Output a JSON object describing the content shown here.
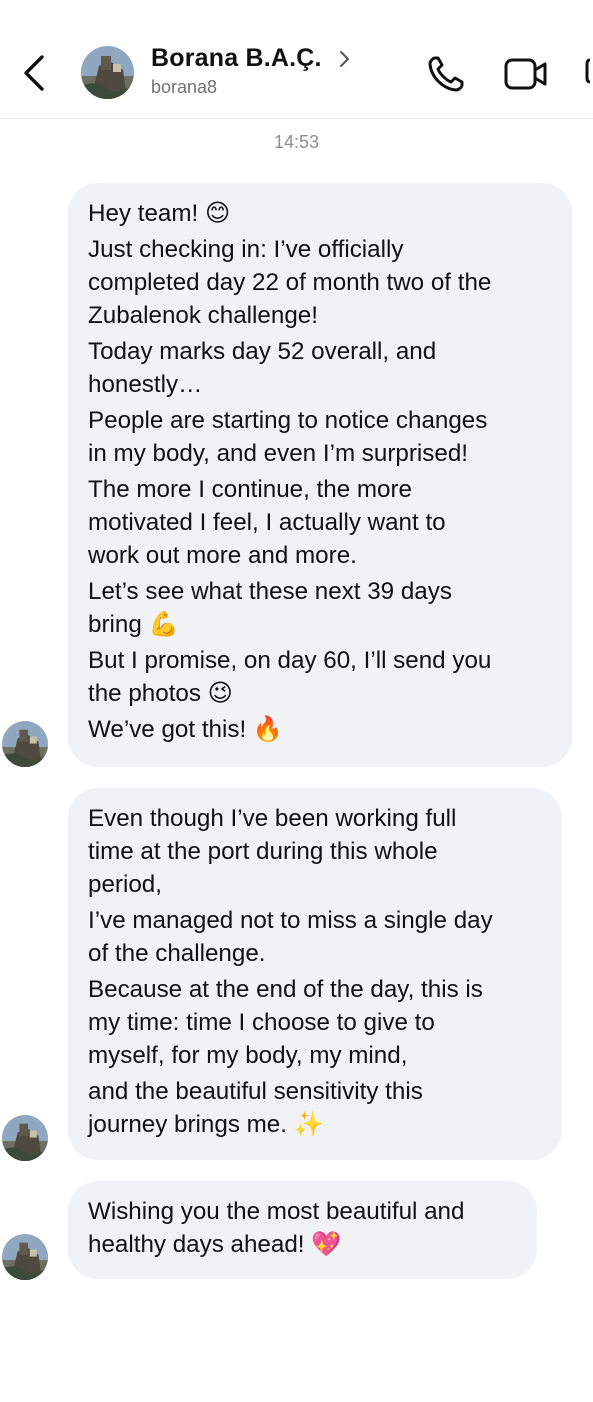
{
  "header": {
    "contact_name": "Borana B.A.Ç.",
    "username": "borana8",
    "icons": {
      "back": "chevron-left-icon",
      "name_chevron": "chevron-right-icon",
      "call": "phone-icon",
      "video": "video-camera-icon"
    }
  },
  "thread": {
    "timestamp": "14:53",
    "messages": [
      {
        "lines": [
          "Hey team! 😊",
          "Just checking in: I’ve officially",
          "completed day 22 of month two of the",
          "Zubalenok challenge!",
          "Today marks day 52 overall, and",
          "honestly…",
          "People are starting to notice changes",
          "in my body, and even I’m surprised!",
          "The more I continue, the more",
          "motivated I feel, I actually want to",
          "work out more and more.",
          "Let’s see what these next 39 days",
          "bring 💪",
          "But I promise, on day 60, I’ll send you",
          "the photos 😉",
          "We’ve got this! 🔥"
        ]
      },
      {
        "lines": [
          "Even though I’ve been working full",
          "time at the port during this whole",
          "period,",
          "I’ve managed not to miss a single day",
          "of the challenge.",
          "Because at the end of the day, this is",
          "my time: time I choose to give to",
          "myself, for my body, my mind,",
          "and the beautiful sensitivity this",
          "journey brings me. ✨"
        ]
      },
      {
        "lines": [
          "Wishing you the most beautiful and",
          "healthy days ahead! 💖"
        ]
      }
    ]
  },
  "colors": {
    "bubble": "#f1f2f4",
    "secondary_text": "#737373",
    "divider": "#efefef"
  }
}
